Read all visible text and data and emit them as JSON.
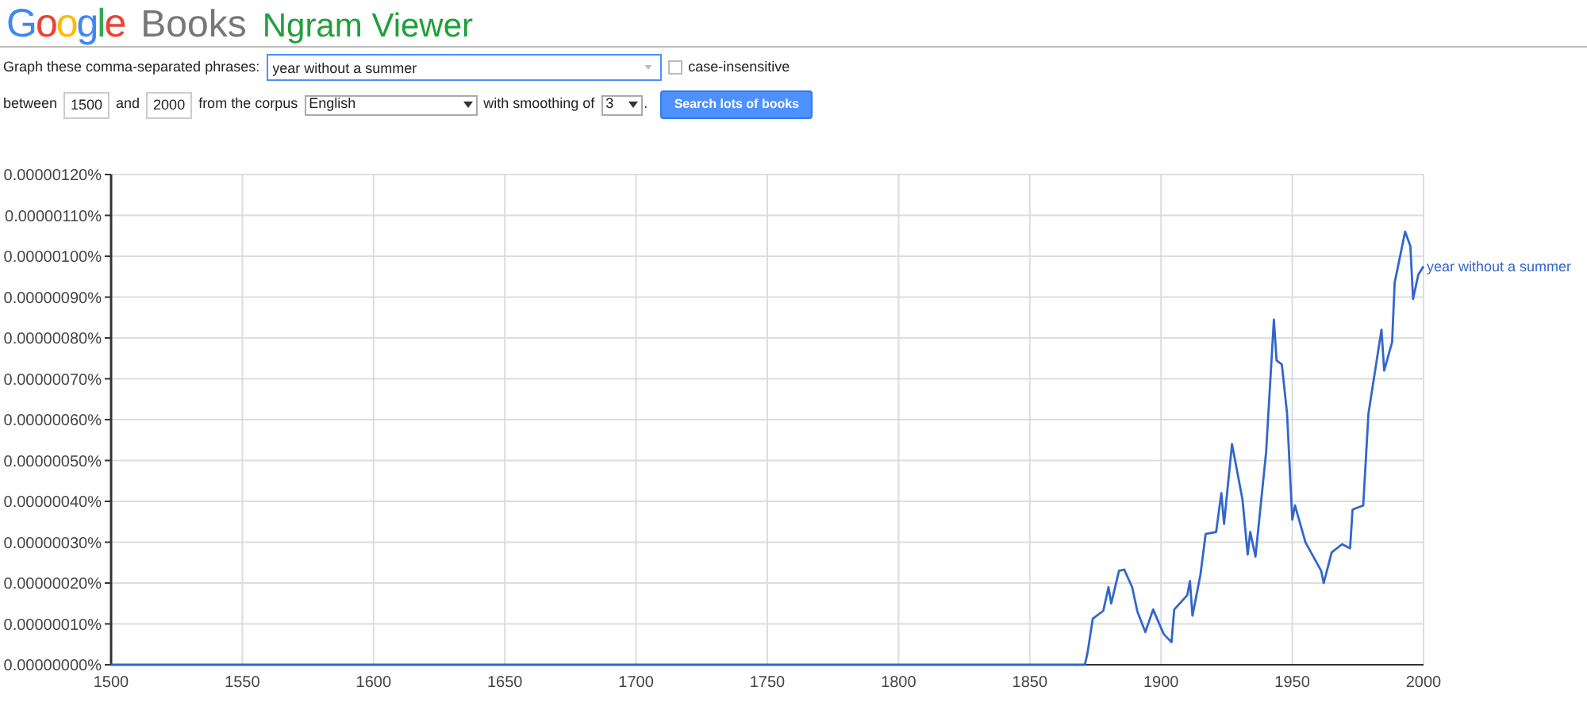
{
  "header": {
    "logo": "Google",
    "product": "Books",
    "title": "Ngram Viewer"
  },
  "query": {
    "label": "Graph these comma-separated phrases:",
    "value": "year without a summer",
    "case_insensitive": {
      "label": "case-insensitive",
      "checked": false
    }
  },
  "range": {
    "between_label": "between",
    "start": "1500",
    "and_label": "and",
    "end": "2000",
    "corpus_label": "from the corpus",
    "corpus": "English",
    "smoothing_label": "with smoothing of",
    "smoothing": "3",
    "period": ".",
    "button": "Search lots of books"
  },
  "chart_data": {
    "type": "line",
    "x": [
      1500,
      1871,
      1872,
      1874,
      1878,
      1880,
      1881,
      1884,
      1886,
      1889,
      1891,
      1894,
      1897,
      1901,
      1904,
      1905,
      1910,
      1911,
      1912,
      1915,
      1917,
      1921,
      1923,
      1924,
      1927,
      1931,
      1933,
      1934,
      1936,
      1940,
      1943,
      1944,
      1946,
      1948,
      1950,
      1951,
      1955,
      1961,
      1962,
      1965,
      1969,
      1972,
      1973,
      1977,
      1979,
      1984,
      1985,
      1988,
      1989,
      1993,
      1995,
      1996,
      1998,
      2000
    ],
    "series": [
      {
        "name": "year without a summer",
        "color": "#3366cc",
        "values": [
          0,
          0,
          3e-08,
          1.13e-07,
          1.32e-07,
          1.9e-07,
          1.5e-07,
          2.3e-07,
          2.33e-07,
          1.9e-07,
          1.3e-07,
          8e-08,
          1.35e-07,
          7.5e-08,
          5.5e-08,
          1.35e-07,
          1.7e-07,
          2.05e-07,
          1.2e-07,
          2.2e-07,
          3.2e-07,
          3.25e-07,
          4.2e-07,
          3.45e-07,
          5.4e-07,
          4.05e-07,
          2.7e-07,
          3.25e-07,
          2.65e-07,
          5.2e-07,
          8.45e-07,
          7.45e-07,
          7.35e-07,
          6.15e-07,
          3.55e-07,
          3.9e-07,
          3e-07,
          2.3e-07,
          2e-07,
          2.75e-07,
          2.95e-07,
          2.85e-07,
          3.8e-07,
          3.9e-07,
          6.15e-07,
          8.2e-07,
          7.2e-07,
          7.9e-07,
          9.35e-07,
          1.06e-06,
          1.025e-06,
          8.95e-07,
          9.55e-07,
          9.75e-07
        ]
      }
    ],
    "grid": true,
    "xlim": [
      1500,
      2000
    ],
    "ylim": [
      0,
      1.2e-06
    ],
    "xticks": [
      1500,
      1550,
      1600,
      1650,
      1700,
      1750,
      1800,
      1850,
      1900,
      1950,
      2000
    ],
    "yticks": [
      {
        "value": 0,
        "label": "0.00000000%"
      },
      {
        "value": 1e-07,
        "label": "0.00000010%"
      },
      {
        "value": 2e-07,
        "label": "0.00000020%"
      },
      {
        "value": 3e-07,
        "label": "0.00000030%"
      },
      {
        "value": 4e-07,
        "label": "0.00000040%"
      },
      {
        "value": 5e-07,
        "label": "0.00000050%"
      },
      {
        "value": 6e-07,
        "label": "0.00000060%"
      },
      {
        "value": 7e-07,
        "label": "0.00000070%"
      },
      {
        "value": 8e-07,
        "label": "0.00000080%"
      },
      {
        "value": 9e-07,
        "label": "0.00000090%"
      },
      {
        "value": 1e-06,
        "label": "0.00000100%"
      },
      {
        "value": 1.1e-06,
        "label": "0.00000110%"
      },
      {
        "value": 1.2e-06,
        "label": "0.00000120%"
      }
    ]
  }
}
